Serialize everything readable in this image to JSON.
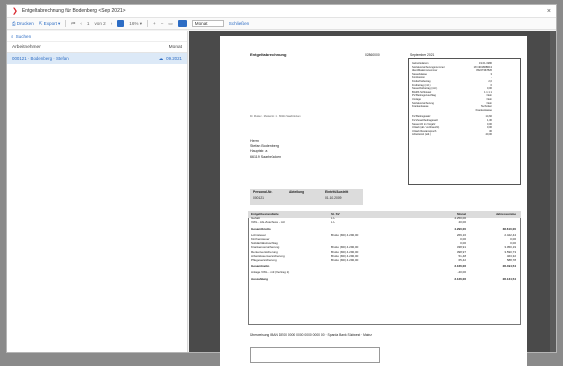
{
  "window": {
    "title": "Entgeltabrechnung für Bodenberg <Sep 2021>",
    "close": "×"
  },
  "toolbar": {
    "print": "Drucken",
    "export": "Export",
    "page": "1",
    "page_of": "von 2",
    "zoom": "16% ▾",
    "view_select": "Monat",
    "close_link": "Schließen"
  },
  "sidebar": {
    "search_placeholder": "Suchen",
    "col_employee": "Arbeitnehmer",
    "col_month": "Monat",
    "row": {
      "employee": "000121 · Bodenberg · Stefan",
      "month": "09.2021"
    }
  },
  "document": {
    "title": "Entgeltabrechnung",
    "code": "02860000",
    "period": "September 2021",
    "sender": "Dr. Muster · Musterstr. 1 · 66111 Saarbrücken",
    "recipient": [
      "Herrn",
      "Stefan Bodenberg",
      "Hauptstr. a",
      "66119 Saarbrücken"
    ],
    "info_pairs": [
      [
        "Geburtsdatum",
        "19.01.1980"
      ],
      [
        "Sozialversicherungsnummer",
        "18 190180B013"
      ],
      [
        "Identifikationsnummer",
        "05227367826"
      ],
      [
        "Steuerklasse",
        "3"
      ],
      [
        "Konfession",
        "-"
      ],
      [
        "Kinderfreibetrag",
        "2,0"
      ],
      [
        "Freibetrag (mtl.)",
        "0"
      ],
      [
        "Steuerfreibetrag (mtl.)",
        "0,00"
      ],
      [
        "BGRS Schlüssel",
        "1 1 1 1"
      ],
      [
        "PV-Beitragszuschlag",
        "Nein"
      ],
      [
        "Umlage",
        "Nein"
      ],
      [
        "Sozialversicherung",
        "Nein"
      ],
      [
        "Krankenkasse",
        "Techniker"
      ],
      [
        "",
        "Krankenkasse"
      ],
      [
        "KV-Beitragssatz",
        "14,60"
      ],
      [
        "KV-Zusatzbeitragssatz",
        "1,30"
      ],
      [
        "Steuer-ID im Vorjahr",
        "0,00"
      ],
      [
        "Urlaub (alt / verbraucht)",
        "0,00"
      ],
      [
        "Urlaub Restanspruch",
        "30"
      ],
      [
        "Arbeitszeit (std.)",
        "40,00"
      ]
    ],
    "pers_header": [
      "Personal-Nr.",
      "Abteilung",
      "Eintritt/Austritt"
    ],
    "pers_values": [
      "000121",
      "",
      "01.10.2009"
    ],
    "table_header": [
      "Entgeltbestandteile",
      "St. SV",
      "Monat",
      "Jahressumme"
    ],
    "lines": [
      [
        "Gehalt",
        "L L",
        "4.250,00",
        ""
      ],
      [
        "VWL - AG-Zuschuss - mtl",
        "L L",
        "40,00",
        ""
      ],
      [
        "Gesamtbrutto",
        "",
        "4.290,00",
        "38.610,00"
      ],
      [
        "Lohnsteuer",
        "Brutto (Mtl)  4.290,00",
        "269,16",
        "2.422,44"
      ],
      [
        "Kirchensteuer",
        "",
        "0,00",
        "0,00"
      ],
      [
        "Solidaritätszuschlag",
        "",
        "0,00",
        "0,00"
      ],
      [
        "Krankenversicherung",
        "Brutto (Mtl)  4.290,00",
        "338,91",
        "3.050,19"
      ],
      [
        "Rentenversicherung",
        "Brutto (Mtl)  4.290,00",
        "398,97",
        "3.590,73"
      ],
      [
        "Arbeitslosenversicherung",
        "Brutto (Mtl)  4.290,00",
        "51,48",
        "463,32"
      ],
      [
        "Pflegeversicherung",
        "Brutto (Mtl)  4.290,00",
        "65,42",
        "588,78"
      ],
      [
        "Gesamtnetto",
        "",
        "3.166,06",
        "28.494,54"
      ],
      [
        "Anlage VWL - mtl (Vertrag 1)",
        "",
        "-40,00",
        ""
      ],
      [
        "Auszahlung",
        "",
        "3.126,06",
        "28.134,54"
      ]
    ],
    "transfer": "Überweisung   IBAN DE00 0000 0000 0000 0000 00 · Sparda Bank Südwest · Mainz"
  }
}
